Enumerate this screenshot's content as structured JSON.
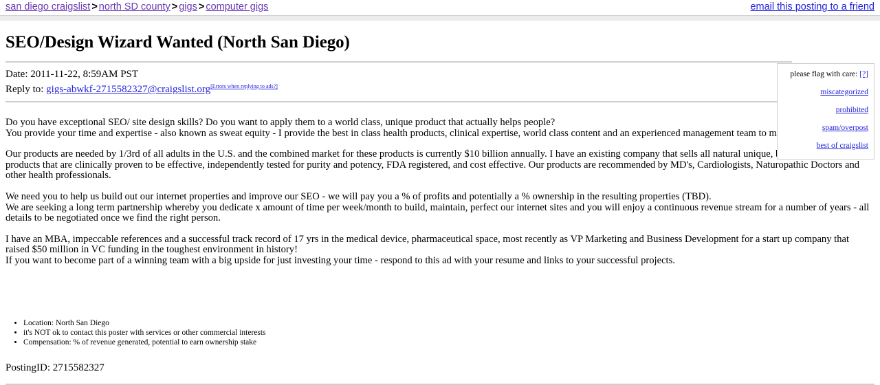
{
  "header": {
    "breadcrumbs": [
      {
        "label": "san diego craigslist"
      },
      {
        "label": "north SD county"
      },
      {
        "label": "gigs"
      },
      {
        "label": "computer gigs"
      }
    ],
    "separator": ">",
    "email_friend_label": "email this posting to a friend"
  },
  "posting": {
    "title": "SEO/Design Wizard Wanted (North San Diego)",
    "date_label": "Date: 2011-11-22, 8:59AM PST",
    "reply_prefix": "Reply to: ",
    "reply_email": "gigs-abwkf-2715582327@craigslist.org",
    "errors_note": "[Errors when replying to ads?]",
    "posting_id": "PostingID: 2715582327"
  },
  "flagbox": {
    "heading": "please flag with care: ",
    "help_label": "[?]",
    "items": [
      {
        "label": "miscategorized"
      },
      {
        "label": "prohibited"
      },
      {
        "label": "spam/overpost"
      },
      {
        "label": "best of craigslist"
      }
    ]
  },
  "body": {
    "paragraphs": [
      "Do you have exceptional SEO/ site design skills? Do you want to apply them to a world class, unique product that actually helps people?\nYou provide your time and expertise - also known as sweat equity - I provide the best in class health products, clinical expertise, world class content and an experienced management team to make the whole thing go.",
      "Our products are needed by 1/3rd of all adults in the U.S. and the combined market for these products is currently $10 billion annually. I have an existing company that sells all natural unique, best in class health products that are clinically proven to be effective, independently tested for purity and potency, FDA registered, and cost effective. Our products are recommended by MD's, Cardiologists, Naturopathic Doctors and other health professionals.",
      "We need you to help us build out our internet properties and improve our SEO - we will pay you a % of profits and potentially a % ownership in the resulting properties (TBD).\nWe are seeking a long term partnership whereby you dedicate x amount of time per week/month to build, maintain, perfect our internet sites and you will enjoy a continuous revenue stream for a number of years - all details to be negotiated once we find the right person.",
      "I have an MBA, impeccable references and a successful track record of 17 yrs in the medical device, pharmaceutical space, most recently as VP Marketing and Business Development for a start up company that raised $50 million in VC funding in the toughest environment in history!\nIf you want to become part of a winning team with a big upside for just investing your time - respond to this ad with your resume and links to your successful projects."
    ]
  },
  "attributes": [
    {
      "label": "Location: North San Diego"
    },
    {
      "label": "it's NOT ok to contact this poster with services or other commercial interests"
    },
    {
      "label": "Compensation: % of revenue generated, potential to earn ownership stake"
    }
  ],
  "colors": {
    "crumb_link": "#6a3ab2",
    "link": "#2222dd",
    "band": "#ececec",
    "rule": "#cfcfcf"
  }
}
